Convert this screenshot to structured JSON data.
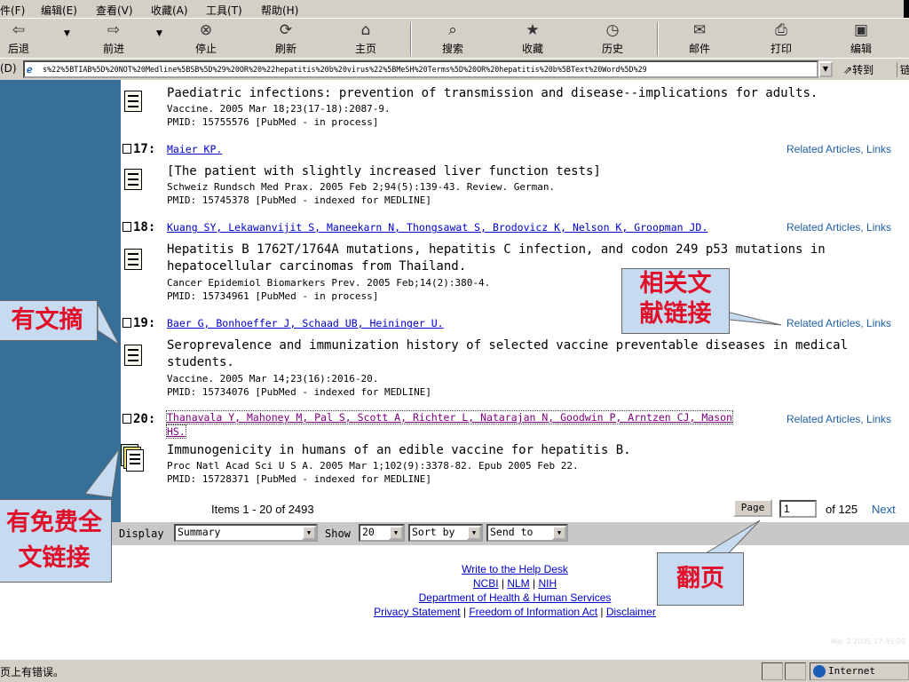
{
  "menu": {
    "items": [
      "件(F)",
      "编辑(E)",
      "查看(V)",
      "收藏(A)",
      "工具(T)",
      "帮助(H)"
    ]
  },
  "toolbar": {
    "back": {
      "label": "后退",
      "icon": "back-arrow-icon"
    },
    "forward": {
      "label": "前进",
      "icon": "forward-arrow-icon"
    },
    "stop": {
      "label": "停止",
      "icon": "stop-icon"
    },
    "refresh": {
      "label": "刷新",
      "icon": "refresh-icon"
    },
    "home": {
      "label": "主页",
      "icon": "home-icon"
    },
    "search": {
      "label": "搜索",
      "icon": "search-icon"
    },
    "favorites": {
      "label": "收藏",
      "icon": "favorites-icon"
    },
    "history": {
      "label": "历史",
      "icon": "history-icon"
    },
    "mail": {
      "label": "邮件",
      "icon": "mail-icon"
    },
    "print": {
      "label": "打印",
      "icon": "print-icon"
    },
    "edit": {
      "label": "编辑",
      "icon": "edit-icon"
    }
  },
  "address": {
    "label": "(D)",
    "url": "s%22%5BTIAB%5D%20NOT%20Medline%5BSB%5D%29%20OR%20%22hepatitis%20b%20virus%22%5BMeSH%20Terms%5D%20OR%20hepatitis%20b%5BText%20Word%5D%29",
    "go_label": "转到",
    "links_label": "链"
  },
  "results": [
    {
      "number": "",
      "authors": "",
      "title_lines": [
        "Paediatric infections: prevention of transmission and disease--implications for adults."
      ],
      "citation": "Vaccine. 2005 Mar 18;23(17-18):2087-9.",
      "pmid": "PMID: 15755576 [PubMed - in process]",
      "related": ""
    },
    {
      "number": "17:",
      "authors": "Maier KP.",
      "title_lines": [
        "[The patient with slightly increased liver function tests]"
      ],
      "citation": "Schweiz Rundsch Med Prax. 2005 Feb 2;94(5):139-43. Review. German.",
      "pmid": "PMID: 15745378 [PubMed - indexed for MEDLINE]",
      "related": "Related Articles,  Links"
    },
    {
      "number": "18:",
      "authors": "Kuang SY, Lekawanvijit S, Maneekarn N, Thongsawat S, Brodovicz K, Nelson K, Groopman JD.",
      "title_lines": [
        "Hepatitis B 1762T/1764A mutations, hepatitis C infection, and codon 249 p53 mutations in",
        "hepatocellular carcinomas from Thailand."
      ],
      "citation": "Cancer Epidemiol Biomarkers Prev. 2005 Feb;14(2):380-4.",
      "pmid": "PMID: 15734961 [PubMed - in process]",
      "related": "Related Articles,  Links"
    },
    {
      "number": "19:",
      "authors": "Baer G, Bonhoeffer J, Schaad UB, Heininger U.",
      "title_lines": [
        "Seroprevalence and immunization history of selected vaccine preventable diseases in medical",
        "students."
      ],
      "citation": "Vaccine. 2005 Mar 14;23(16):2016-20.",
      "pmid": "PMID: 15734076 [PubMed - indexed for MEDLINE]",
      "related": "Related Articles,  Links"
    },
    {
      "number": "20:",
      "authors_lines": [
        "Thanavala Y, Mahoney M, Pal S, Scott A, Richter L, Natarajan N, Goodwin P, Arntzen CJ, Mason",
        "HS."
      ],
      "title_lines": [
        "Immunogenicity in humans of an edible vaccine for hepatitis B."
      ],
      "citation": "Proc Natl Acad Sci U S A. 2005 Mar 1;102(9):3378-82. Epub 2005 Feb 22.",
      "pmid": "PMID: 15728371 [PubMed - indexed for MEDLINE]",
      "related": "Related Articles,  Links"
    }
  ],
  "pager": {
    "items_text": "Items 1 - 20 of 2493",
    "page_button": "Page",
    "page_value": "1",
    "of_text": "of 125",
    "next": "Next"
  },
  "display_controls": {
    "display_label": "Display",
    "display_value": "Summary",
    "show_label": "Show",
    "show_value": "20",
    "sort_value": "Sort by",
    "send_value": "Send to"
  },
  "footer": {
    "help": "Write to the Help Desk",
    "ncbi": "NCBI",
    "nlm": "NLM",
    "nih": "NIH",
    "sep": " | ",
    "dhhs": "Department of Health & Human Services",
    "privacy": "Privacy Statement",
    "foia": "Freedom of Information Act",
    "disclaimer": "Disclaimer",
    "timestamp": "Mar 2 2005 17:45:09"
  },
  "status": {
    "text": "页上有错误。",
    "zone": "Internet"
  },
  "callouts": {
    "abstract": "有文摘",
    "related_line1": "相关文",
    "related_line2": "献链接",
    "fulltext_line1": "有免费全",
    "fulltext_line2": "文链接",
    "paging": "翻页"
  },
  "colors": {
    "sidebar": "#36709a",
    "link": "#0000cc",
    "related_link": "#1f5fa8",
    "callout_bg": "#c6daf0",
    "callout_text": "#e0102a",
    "chrome": "#d4d0c8"
  }
}
